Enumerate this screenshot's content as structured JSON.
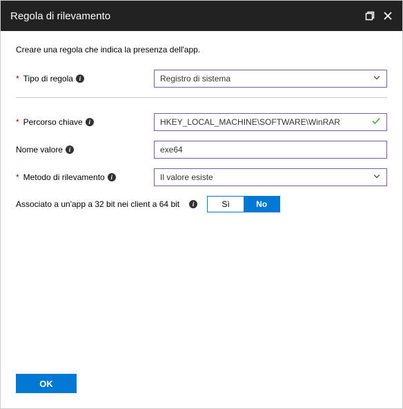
{
  "header": {
    "title": "Regola di rilevamento"
  },
  "intro": "Creare una regola che indica la presenza dell'app.",
  "fields": {
    "ruleType": {
      "label": "Tipo di regola",
      "value": "Registro di sistema"
    },
    "keyPath": {
      "label": "Percorso chiave",
      "value": "HKEY_LOCAL_MACHINE\\SOFTWARE\\WinRAR"
    },
    "valueName": {
      "label": "Nome valore",
      "value": "exe64"
    },
    "method": {
      "label": "Metodo di rilevamento",
      "value": "Il valore esiste"
    }
  },
  "toggle": {
    "label": "Associato a un'app a 32 bit nei client a 64 bit",
    "yes": "Sì",
    "no": "No"
  },
  "footer": {
    "ok": "OK"
  }
}
